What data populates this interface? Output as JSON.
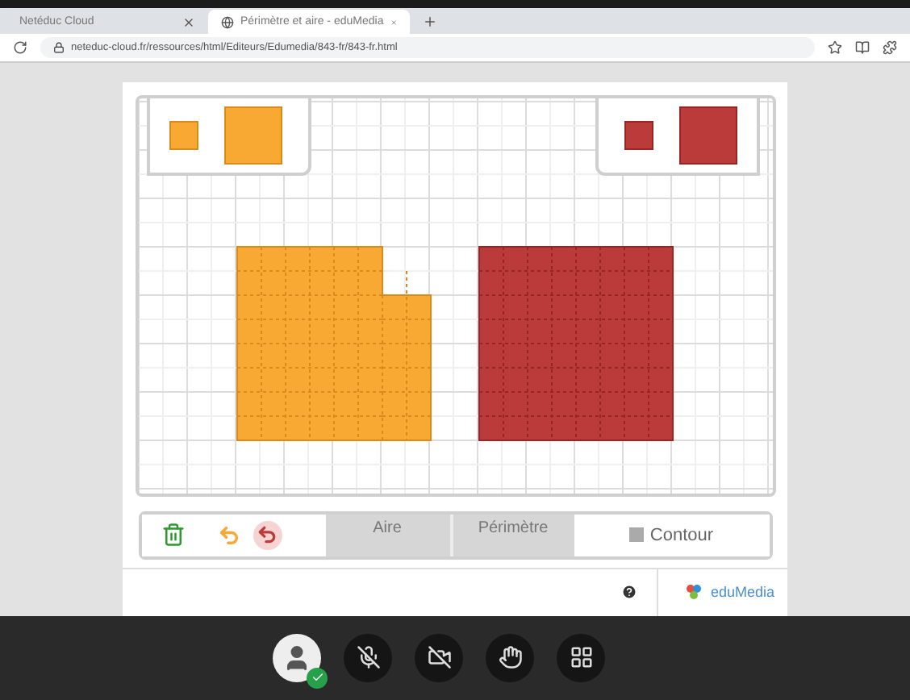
{
  "browser": {
    "tabs": [
      {
        "title": "Netéduc Cloud",
        "selected": false
      },
      {
        "title": "Périmètre et aire - eduMedia",
        "selected": true
      }
    ],
    "url": "neteduc-cloud.fr/ressources/html/Editeurs/Edumedia/843-fr/843-fr.html"
  },
  "app": {
    "modes": [
      {
        "label": "Aire",
        "selected": false
      },
      {
        "label": "Périmètre",
        "selected": false
      }
    ],
    "contour": {
      "label": "Contour",
      "checked": false
    }
  },
  "footer": {
    "logo": "eduMedia"
  }
}
